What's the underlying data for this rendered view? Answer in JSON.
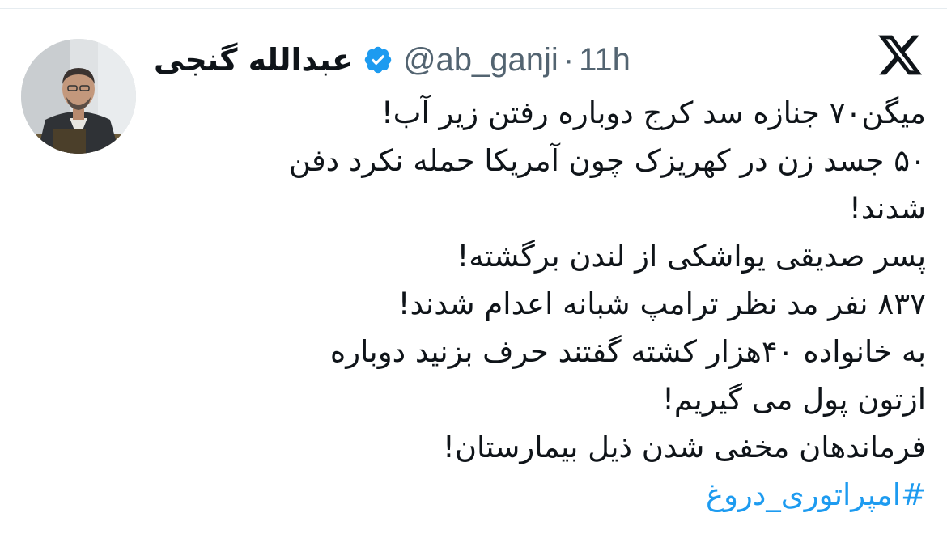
{
  "app": {
    "logo_icon": "x-logo-icon"
  },
  "author": {
    "display_name": "عبدالله گنجی",
    "verified_icon": "verified-badge-icon",
    "handle": "@ab_ganji",
    "separator": "·",
    "time": "11h",
    "avatar": "avatar-photo"
  },
  "tweet": {
    "lines": [
      "میگن۷۰ جنازه سد کرج دوباره رفتن زیر آب!",
      "۵۰ جسد زن در کهریزک چون آمریکا حمله نکرد دفن",
      "شدند!",
      "پسر صدیقی یواشکی از لندن برگشته!",
      "۸۳۷ نفر مد نظر ترامپ شبانه اعدام شدند!",
      "به خانواده ۴۰هزار کشته گفتند حرف بزنید دوباره",
      "ازتون پول می گیریم!",
      "فرماندهان مخفی شدن ذیل بیمارستان!"
    ],
    "hashtag": "#امپراتوری_دروغ"
  },
  "colors": {
    "text": "#0f1419",
    "secondary": "#536471",
    "link": "#1d9bf0",
    "verified": "#1d9bf0"
  }
}
